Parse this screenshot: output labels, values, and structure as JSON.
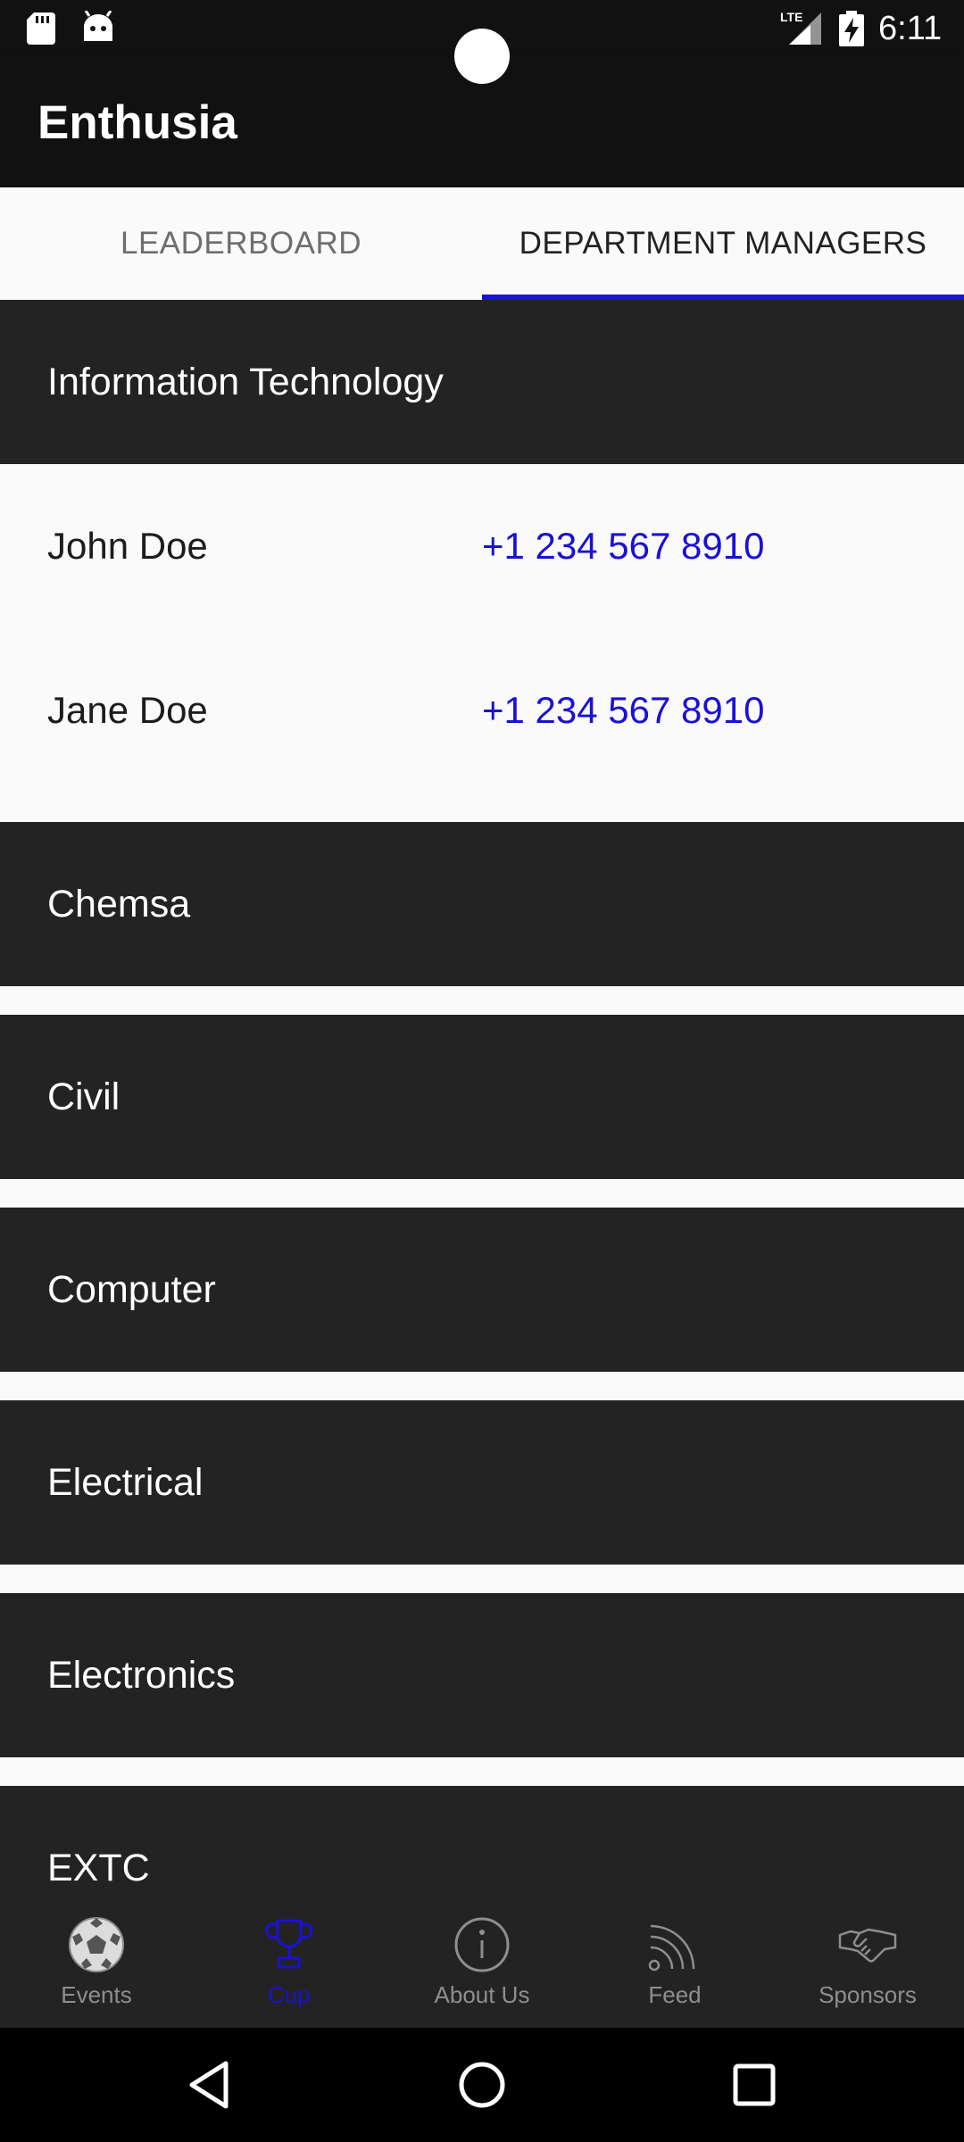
{
  "status_bar": {
    "time": "6:11",
    "network": "LTE",
    "icons": [
      "sd-card-icon",
      "android-icon",
      "lte-signal-icon",
      "battery-charging-icon"
    ]
  },
  "app_bar": {
    "title": "Enthusia"
  },
  "tabs": [
    {
      "label": "LEADERBOARD",
      "selected": false
    },
    {
      "label": "DEPARTMENT MANAGERS",
      "selected": true
    }
  ],
  "departments": [
    {
      "name": "Information Technology",
      "expanded": true,
      "managers": [
        {
          "name": "John Doe",
          "phone": "+1 234 567 8910"
        },
        {
          "name": "Jane Doe",
          "phone": "+1 234 567 8910"
        }
      ]
    },
    {
      "name": "Chemsa",
      "expanded": false
    },
    {
      "name": "Civil",
      "expanded": false
    },
    {
      "name": "Computer",
      "expanded": false
    },
    {
      "name": "Electrical",
      "expanded": false
    },
    {
      "name": "Electronics",
      "expanded": false
    },
    {
      "name": "EXTC",
      "expanded": false
    }
  ],
  "bottom_nav": [
    {
      "label": "Events",
      "icon": "soccer-ball-icon",
      "active": false
    },
    {
      "label": "Cup",
      "icon": "trophy-icon",
      "active": true
    },
    {
      "label": "About Us",
      "icon": "info-icon",
      "active": false
    },
    {
      "label": "Feed",
      "icon": "rss-feed-icon",
      "active": false
    },
    {
      "label": "Sponsors",
      "icon": "handshake-icon",
      "active": false
    }
  ],
  "colors": {
    "accent": "#1a10d6",
    "dark_bar": "#111111",
    "header_bg": "#232323",
    "page_bg": "#fafafa"
  }
}
